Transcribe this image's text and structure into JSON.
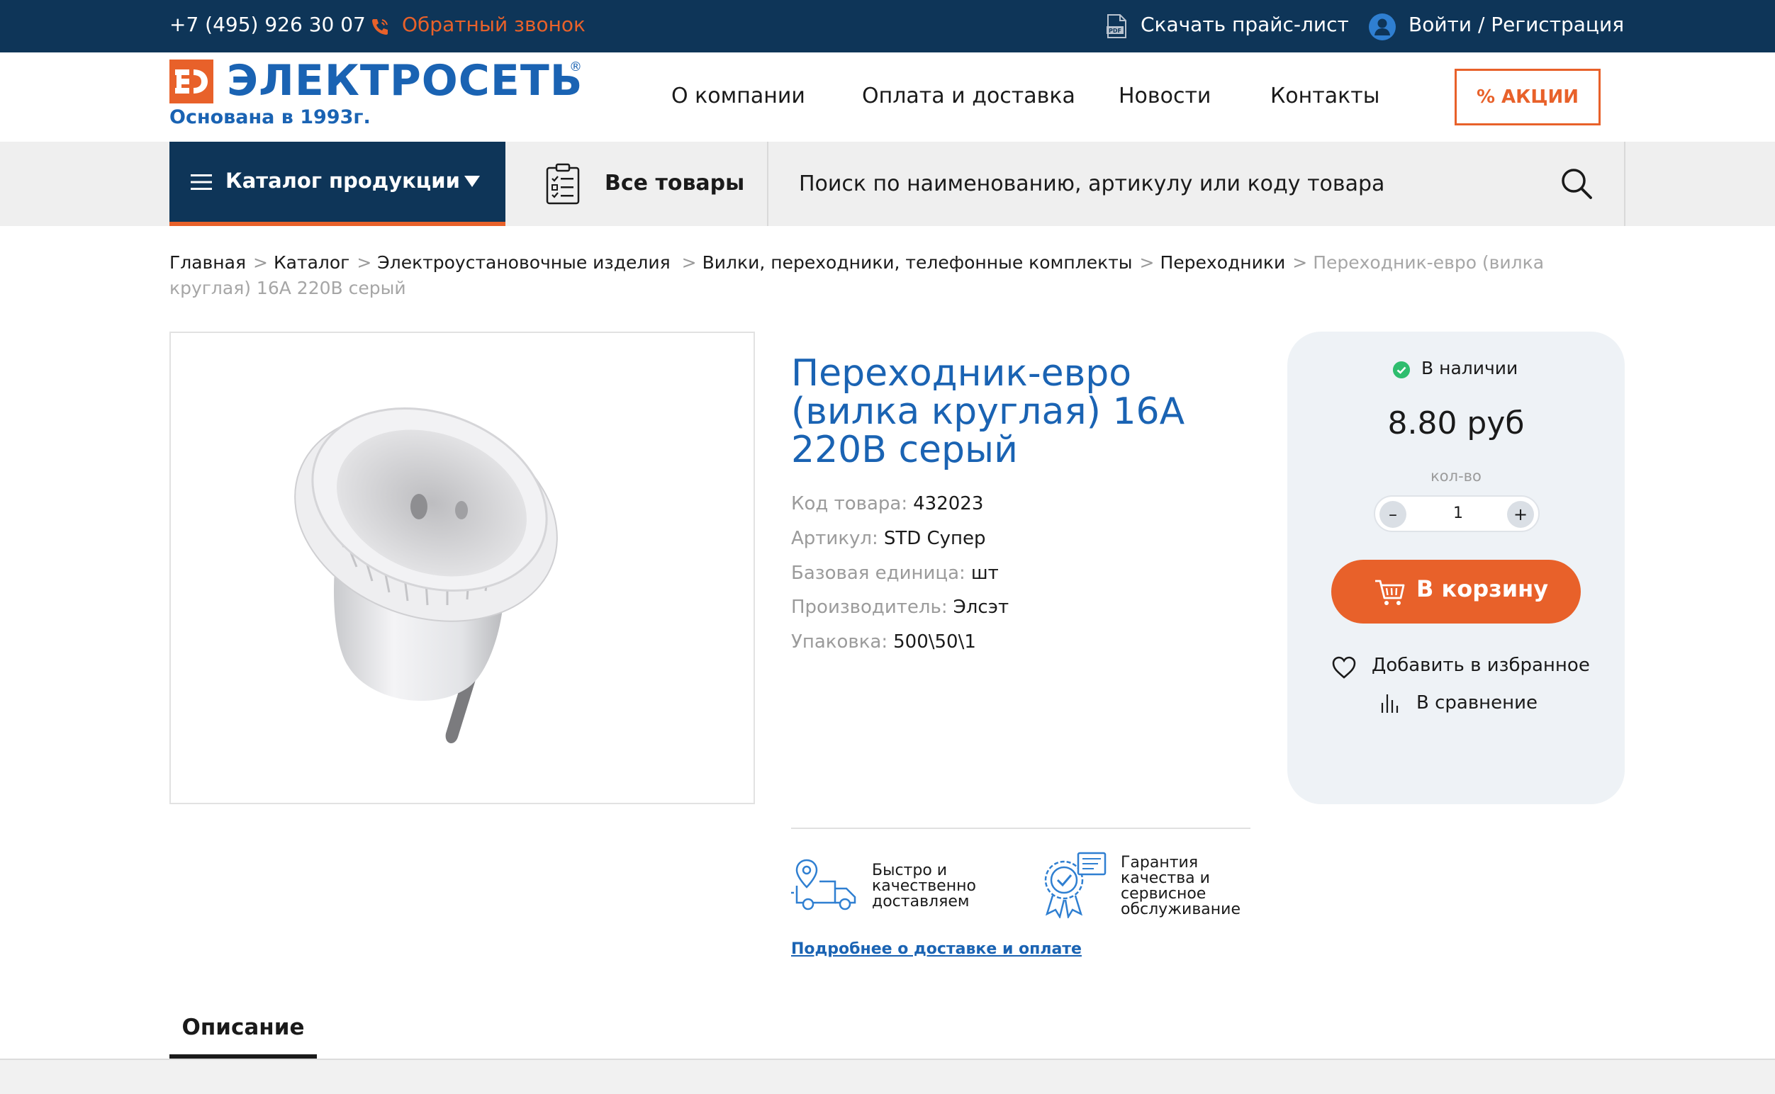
{
  "topbar": {
    "phone": "+7 (495) 926 30 07",
    "callback": "Обратный звонок",
    "pricelist": "Скачать прайс-лист",
    "login": "Войти / Регистрация"
  },
  "header": {
    "logo_name": "ЭЛЕКТРОСЕТЬ",
    "logo_reg": "®",
    "logo_sub": "Основана в 1993г.",
    "nav": [
      "О компании",
      "Оплата и доставка",
      "Новости",
      "Контакты"
    ],
    "promo": "% АКЦИИ"
  },
  "catalog_bar": {
    "catalog_label": "Каталог продукции",
    "all_goods": "Все товары",
    "search_placeholder": "Поиск по наименованию, артикулу или коду товара"
  },
  "breadcrumbs": {
    "items": [
      "Главная",
      "Каталог",
      "Электроустановочные изделия",
      "Вилки, переходники, телефонные комплекты",
      "Переходники"
    ],
    "separator": ">",
    "current": "Переходник-евро (вилка круглая) 16А 220В серый"
  },
  "product": {
    "title": "Переходник-евро (вилка круглая) 16А 220В серый",
    "props": [
      {
        "k": "Код товара:",
        "v": "432023"
      },
      {
        "k": "Артикул:",
        "v": "STD Супер"
      },
      {
        "k": "Базовая единица:",
        "v": "шт"
      },
      {
        "k": "Производитель:",
        "v": "Элсэт"
      },
      {
        "k": "Упаковка:",
        "v": "500\\50\\1"
      }
    ],
    "features": [
      "Быстро и качественно доставляем",
      "Гарантия качества и сервисное обслуживание"
    ],
    "delivery_link": "Подробнее о доставке и оплате"
  },
  "buy_panel": {
    "stock": "В наличии",
    "price": "8.80 руб",
    "qty_label": "кол-во",
    "qty_minus": "–",
    "qty_value": "1",
    "qty_plus": "+",
    "cart": "В корзину",
    "favorite": "Добавить в избранное",
    "compare": "В сравнение"
  },
  "tabs": [
    "Описание"
  ],
  "colors": {
    "navy": "#0e3558",
    "accent": "#e8612a",
    "brand_blue": "#1a63b3",
    "in_stock": "#2ebd6e"
  }
}
